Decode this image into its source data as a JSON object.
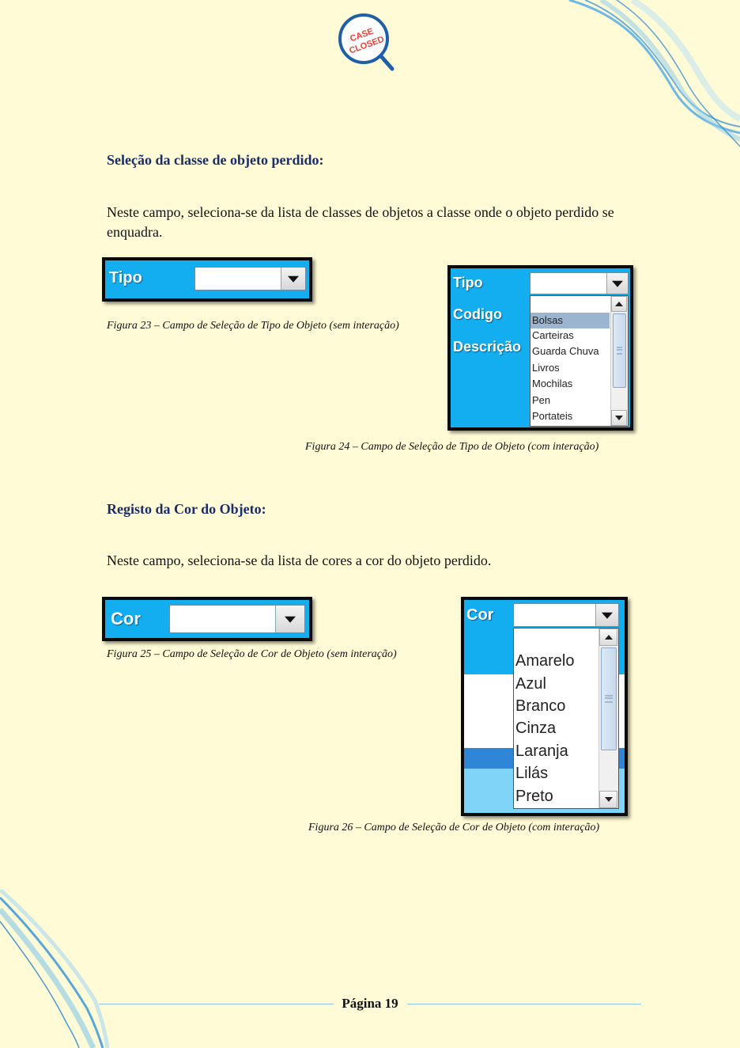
{
  "logo": {
    "line1": "CASE",
    "line2": "CLOSED"
  },
  "section1": {
    "heading": "Seleção da classe de objeto perdido:",
    "paragraph": "Neste campo, seleciona-se da lista de classes de objetos a classe onde o objeto perdido se enquadra."
  },
  "fig23": {
    "label": "Tipo",
    "caption": "Figura 23 – Campo de Seleção de Tipo de Objeto (sem interação)"
  },
  "fig24": {
    "labels": [
      "Tipo",
      "Codigo",
      "Descrição"
    ],
    "options": [
      "Bolsas",
      "Carteiras",
      "Guarda Chuva",
      "Livros",
      "Mochilas",
      "Pen",
      "Portateis"
    ],
    "selected_option": "Bolsas",
    "caption": "Figura 24 – Campo de Seleção de Tipo de Objeto (com interação)"
  },
  "section2": {
    "heading": "Registo da Cor do Objeto:",
    "paragraph": "Neste campo, seleciona-se da lista de cores a cor do objeto perdido."
  },
  "fig25": {
    "label": "Cor",
    "caption": "Figura 25 – Campo de Seleção de Cor de Objeto (sem interação)"
  },
  "fig26": {
    "label": "Cor",
    "options": [
      "Amarelo",
      "Azul",
      "Branco",
      "Cinza",
      "Laranja",
      "Lilás",
      "Preto"
    ],
    "caption": "Figura 26 – Campo de Seleção de Cor de Objeto (com interação)"
  },
  "footer": {
    "page_label": "Página 19"
  },
  "colors": {
    "widget_blue": "#12aef0",
    "heading_navy": "#1a2d6b",
    "page_bg": "#fffbd6"
  }
}
